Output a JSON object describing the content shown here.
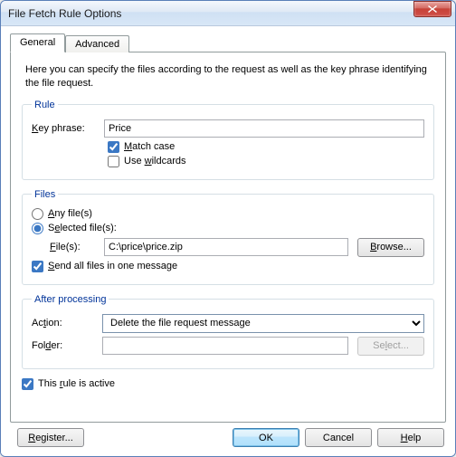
{
  "window": {
    "title": "File Fetch Rule Options"
  },
  "tabs": {
    "general": "General",
    "advanced": "Advanced"
  },
  "intro": "Here you can specify the files according to the request as well as the key phrase identifying the file request.",
  "rule": {
    "legend": "Rule",
    "key_phrase_label_pre": "",
    "key_phrase_label_u": "K",
    "key_phrase_label_post": "ey phrase:",
    "key_phrase_value": "Price",
    "match_case_u": "M",
    "match_case_post": "atch case",
    "match_case_checked": true,
    "use_wildcards_pre": "Use ",
    "use_wildcards_u": "w",
    "use_wildcards_post": "ildcards",
    "use_wildcards_checked": false
  },
  "files": {
    "legend": "Files",
    "any_u": "A",
    "any_post": "ny file(s)",
    "selected_pre": "S",
    "selected_u": "e",
    "selected_post": "lected file(s):",
    "radio_value": "selected",
    "files_label_pre": "",
    "files_label_u": "F",
    "files_label_post": "ile(s):",
    "files_value": "C:\\price\\price.zip",
    "browse_u": "B",
    "browse_post": "rowse...",
    "send_all_u": "S",
    "send_all_post": "end all files in one message",
    "send_all_checked": true
  },
  "after": {
    "legend": "After processing",
    "action_pre": "Ac",
    "action_u": "t",
    "action_post": "ion:",
    "action_value": "Delete the file request message",
    "folder_pre": "Fol",
    "folder_u": "d",
    "folder_post": "er:",
    "folder_value": "",
    "select_pre": "Se",
    "select_u": "l",
    "select_post": "ect..."
  },
  "active": {
    "pre": "This ",
    "u": "r",
    "post": "ule is active",
    "checked": true
  },
  "footer": {
    "register_u": "R",
    "register_post": "egister...",
    "ok": "OK",
    "cancel": "Cancel",
    "help_u": "H",
    "help_post": "elp"
  }
}
